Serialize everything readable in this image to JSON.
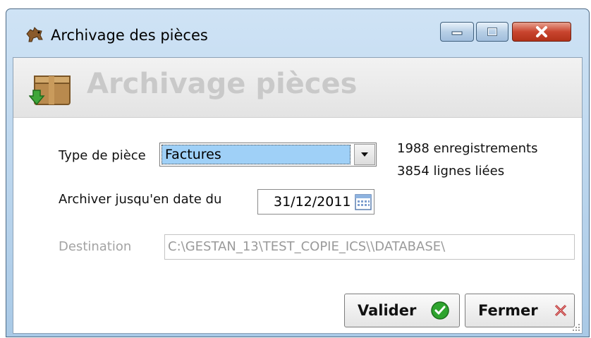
{
  "window": {
    "title": "Archivage des pièces"
  },
  "header": {
    "title": "Archivage pièces"
  },
  "form": {
    "type_label": "Type de pièce",
    "type_value": "Factures",
    "records_count": "1988 enregistrements",
    "linked_lines": "3854 lignes liées",
    "date_label": "Archiver jusqu'en date du",
    "date_value": "31/12/2011",
    "destination_label": "Destination",
    "destination_value": "C:\\GESTAN_13\\TEST_COPIE_ICS\\\\DATABASE\\"
  },
  "buttons": {
    "validate_label": "Valider",
    "close_label": "Fermer"
  },
  "colors": {
    "selection": "#9fd0f7",
    "title_close": "#c9452f",
    "validate_check": "#2ea42e",
    "close_x": "#b01c1c"
  },
  "icons": {
    "app": "dog-icon",
    "header": "archive-box-icon",
    "calendar": "calendar-icon",
    "validate": "check-circle-icon",
    "close": "x-icon"
  }
}
